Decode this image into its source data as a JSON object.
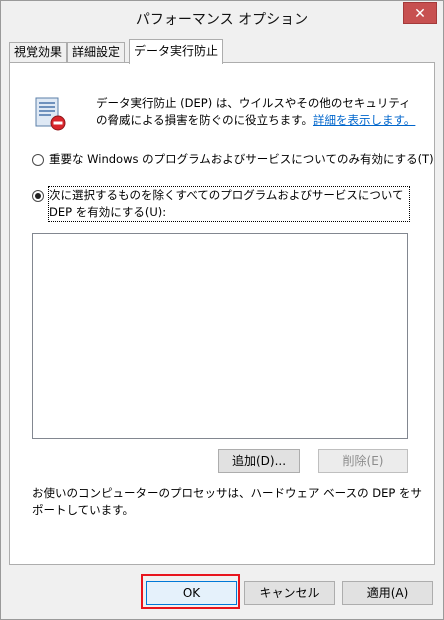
{
  "window": {
    "title": "パフォーマンス オプション",
    "close_glyph": "✕"
  },
  "tabs": [
    {
      "label": "視覚効果"
    },
    {
      "label": "詳細設定"
    },
    {
      "label": "データ実行防止"
    }
  ],
  "description": {
    "text": "データ実行防止 (DEP) は、ウイルスやその他のセキュリティの脅威による損害を防ぐのに役立ちます。",
    "link": "詳細を表示します。"
  },
  "options": [
    {
      "label": "重要な Windows のプログラムおよびサービスについてのみ有効にする(T)",
      "selected": false
    },
    {
      "label": "次に選択するものを除くすべてのプログラムおよびサービスについて DEP を有効にする(U):",
      "selected": true
    }
  ],
  "buttons": {
    "add": "追加(D)...",
    "remove": "削除(E)",
    "ok": "OK",
    "cancel": "キャンセル",
    "apply": "適用(A)"
  },
  "support_text": "お使いのコンピューターのプロセッサは、ハードウェア ベースの DEP をサポートしています。",
  "colors": {
    "accent": "#0078d7",
    "highlight": "#e8141c",
    "link": "#0066cc"
  }
}
